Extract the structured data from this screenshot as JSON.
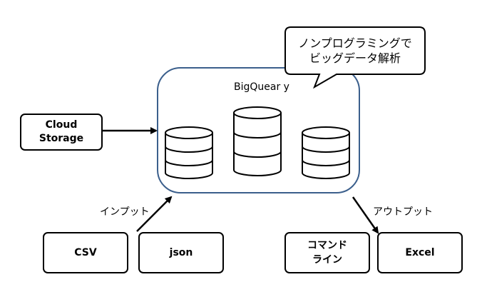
{
  "callout": {
    "line1": "ノンプログラミングで",
    "line2": "ビッグデータ解析"
  },
  "bigquery_label": "BigQuear y",
  "boxes": {
    "cloud_storage": {
      "line1": "Cloud",
      "line2": "Storage"
    },
    "csv": "CSV",
    "json": "json",
    "command_line": {
      "line1": "コマンド",
      "line2": "ライン"
    },
    "excel": "Excel"
  },
  "arrows": {
    "input_label": "インプット",
    "output_label": "アウトプット"
  },
  "colors": {
    "container_border": "#3b5f8c",
    "box_border": "#000000",
    "cylinder_stroke": "#000000"
  }
}
